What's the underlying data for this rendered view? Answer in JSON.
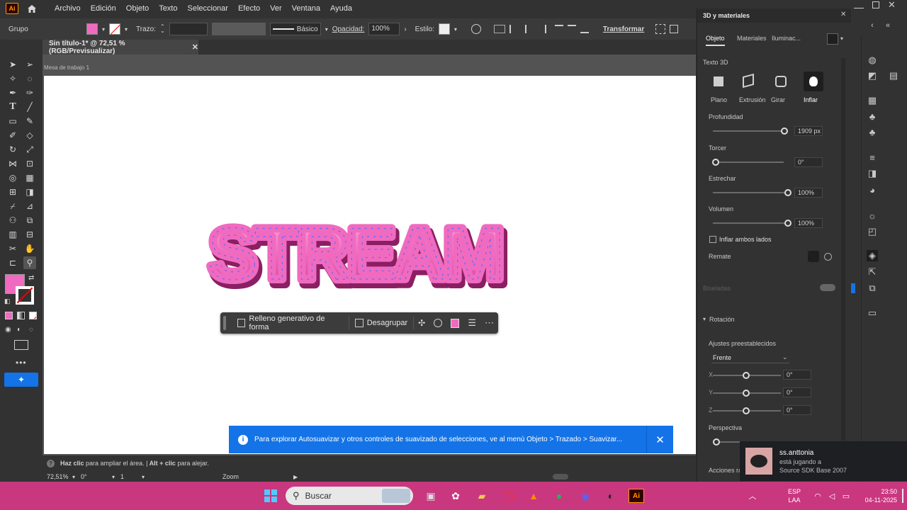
{
  "menu": {
    "items": [
      "Archivo",
      "Edición",
      "Objeto",
      "Texto",
      "Seleccionar",
      "Efecto",
      "Ver",
      "Ventana",
      "Ayuda"
    ],
    "logo": "Ai"
  },
  "control_bar": {
    "group_label": "Grupo",
    "stroke_label": "Trazo:",
    "stroke_style": "Básico",
    "opacity_label": "Opacidad:",
    "opacity_value": "100%",
    "style_label": "Estilo:",
    "transform_label": "Transformar",
    "fill_color": "#f06bbf"
  },
  "document": {
    "tab_title": "Sin título-1* @ 72,51 % (RGB/Previsualizar)",
    "artboard_label": "Mesa de trabajo 1",
    "artwork_text": "STREAM"
  },
  "context_bar": {
    "gen_fill": "Relleno generativo de forma",
    "ungroup": "Desagrupar"
  },
  "notification": {
    "text": "Para explorar Autosuavizar y otros controles de suavizado de selecciones, ve al menú Objeto > Trazado > Suavizar..."
  },
  "status": {
    "hint_bold1": "Haz clic",
    "hint_text1": " para ampliar el área. ",
    "hint_sep": "|",
    "hint_bold2": " Alt + clic",
    "hint_text2": " para alejar.",
    "zoom_value": "72,51%",
    "rotation_value": "0°",
    "artboard_num": "1",
    "zoom_label": "Zoom"
  },
  "panel": {
    "title": "3D y materiales",
    "tabs": [
      "Objeto",
      "Materiales",
      "Iluminac..."
    ],
    "section_3d": "Texto 3D",
    "types": [
      "Plano",
      "Extrusión",
      "Girar",
      "Inflar"
    ],
    "props": [
      {
        "label": "Profundidad",
        "value": "1909 px",
        "level": 0.97
      },
      {
        "label": "Torcer",
        "value": "0°",
        "level": 0.0
      },
      {
        "label": "Estrechar",
        "value": "100%",
        "level": 1.0
      },
      {
        "label": "Volumen",
        "value": "100%",
        "level": 1.0
      }
    ],
    "inflate_both": "Inflar ambos lados",
    "cap_label": "Remate",
    "bevels_label": "Biseladas",
    "rotation_label": "Rotación",
    "presets_label": "Ajustes preestablecidos",
    "preset_value": "Frente",
    "axes": [
      {
        "axis": "X",
        "value": "0°",
        "level": 0.5
      },
      {
        "axis": "Y",
        "value": "0°",
        "level": 0.5
      },
      {
        "axis": "Z",
        "value": "0°",
        "level": 0.5
      }
    ],
    "perspective_label": "Perspectiva",
    "actions_label": "Acciones ráp"
  },
  "toast": {
    "user": "ss.anttonia",
    "status": "está jugando a",
    "game": "Source SDK Base 2007"
  },
  "taskbar": {
    "search": "Buscar",
    "lang1": "ESP",
    "lang2": "LAA",
    "time": "23:50",
    "date": "04-11-2025"
  },
  "colors": {
    "accent": "#1473e6",
    "taskbar": "#c9377f",
    "fill": "#f06bbf"
  }
}
